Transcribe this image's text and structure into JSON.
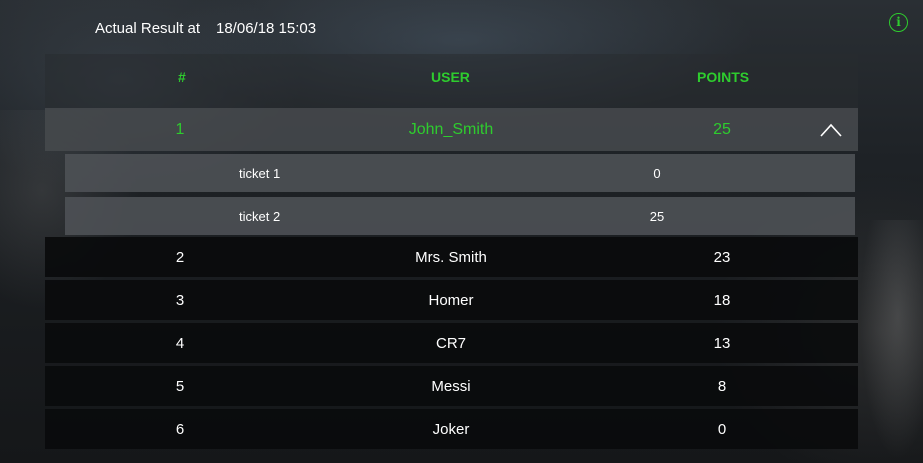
{
  "header": {
    "actual_label": "Actual Result at",
    "timestamp": "18/06/18 15:03",
    "info_icon": "info-icon"
  },
  "columns": {
    "rank": "#",
    "user": "USER",
    "points": "POINTS"
  },
  "colors": {
    "accent": "#2ecc2e"
  },
  "expanded_row": {
    "rank": "1",
    "user": "John_Smith",
    "points": "25",
    "toggle_icon": "chevron-up-icon",
    "tickets": [
      {
        "name": "ticket 1",
        "points": "0"
      },
      {
        "name": "ticket 2",
        "points": "25"
      }
    ]
  },
  "rows": [
    {
      "rank": "2",
      "user": "Mrs. Smith",
      "points": "23"
    },
    {
      "rank": "3",
      "user": "Homer",
      "points": "18"
    },
    {
      "rank": "4",
      "user": "CR7",
      "points": "13"
    },
    {
      "rank": "5",
      "user": "Messi",
      "points": "8"
    },
    {
      "rank": "6",
      "user": "Joker",
      "points": "0"
    }
  ]
}
